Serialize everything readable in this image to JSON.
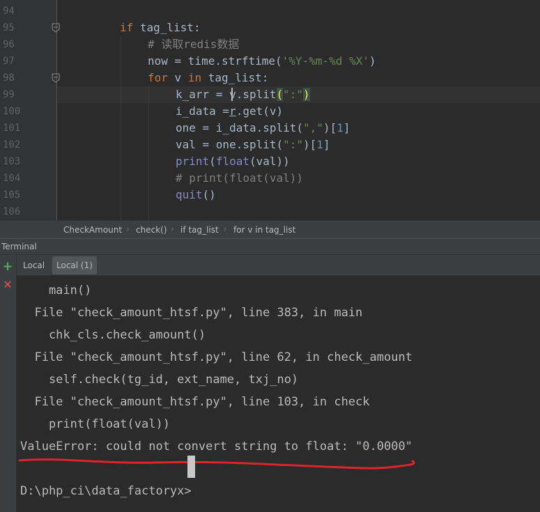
{
  "editor": {
    "line_numbers": [
      "94",
      "95",
      "96",
      "97",
      "98",
      "99",
      "100",
      "101",
      "102",
      "103",
      "104",
      "105",
      "106"
    ],
    "line95": {
      "kw": "if",
      "rest": " tag_list:"
    },
    "line96": {
      "comment": "# 读取redis数据"
    },
    "line97": {
      "pre": "now = time.strftime(",
      "str": "'%Y-%m-%d %X'",
      "post": ")"
    },
    "line98": {
      "kw1": "for",
      "mid1": " v ",
      "kw2": "in",
      "rest": " tag_list:"
    },
    "line99": {
      "pre": "k_arr = v.split",
      "open": "(",
      "str": "\":\"",
      "close": ")"
    },
    "line100": {
      "pre": "i_data =",
      "r": "r",
      "post": ".get(v)"
    },
    "line101": {
      "pre": "one = i_data.split(",
      "str": "\",\"",
      "post": ")[",
      "num": "1",
      "end": "]"
    },
    "line102": {
      "pre": "val = one.split(",
      "str": "\":\"",
      "post": ")[",
      "num": "1",
      "end": "]"
    },
    "line103": {
      "bi": "print",
      "p1": "(",
      "bi2": "float",
      "post": "(val))"
    },
    "line104": {
      "comment": "# print(float(val))"
    },
    "line105": {
      "bi": "quit",
      "post": "()"
    }
  },
  "breadcrumb": [
    "CheckAmount",
    "check()",
    "if tag_list",
    "for v in tag_list"
  ],
  "terminal": {
    "title": "Terminal",
    "tabs": [
      "Local",
      "Local (1)"
    ],
    "toolbar": {
      "add_icon": "plus-icon",
      "close_icon": "close-icon"
    },
    "lines": [
      "    main()",
      "  File \"check_amount_htsf.py\", line 383, in main",
      "    chk_cls.check_amount()",
      "  File \"check_amount_htsf.py\", line 62, in check_amount",
      "    self.check(tg_id, ext_name, txj_no)",
      "  File \"check_amount_htsf.py\", line 103, in check",
      "    print(float(val))",
      "ValueError: could not convert string to float: \"0.0000\"",
      "",
      "D:\\php_ci\\data_factoryx>"
    ]
  },
  "colors": {
    "keyword": "#CC7832",
    "string": "#6A8759",
    "comment": "#808080",
    "builtin": "#8888C6",
    "number": "#6897BB",
    "annotation": "#E0242B"
  }
}
